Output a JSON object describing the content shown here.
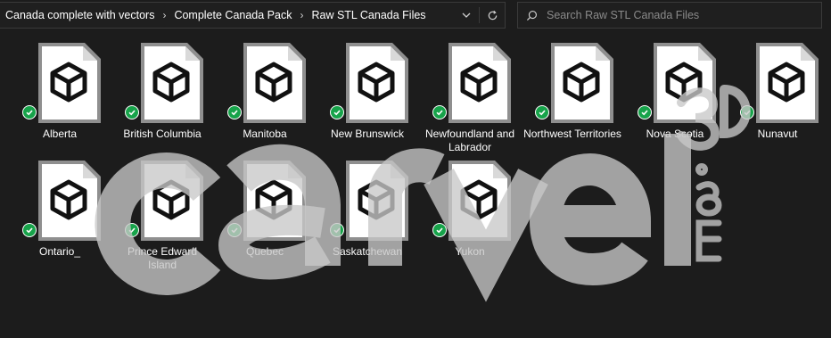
{
  "breadcrumb": {
    "items": [
      "Canada complete with vectors",
      "Complete Canada Pack",
      "Raw STL Canada Files"
    ],
    "separator": "›"
  },
  "search": {
    "placeholder": "Search Raw STL Canada Files"
  },
  "files": [
    {
      "label": "Alberta"
    },
    {
      "label": "British Columbia"
    },
    {
      "label": "Manitoba"
    },
    {
      "label": "New Brunswick"
    },
    {
      "label": "Newfoundland and Labrador"
    },
    {
      "label": "Northwest Territories"
    },
    {
      "label": "Nova Scotia"
    },
    {
      "label": "Nunavut"
    },
    {
      "label": "Ontario_"
    },
    {
      "label": "Prince Edward Island"
    },
    {
      "label": "Quebec"
    },
    {
      "label": "Saskatchewan"
    },
    {
      "label": "Yukon"
    }
  ],
  "watermark": {
    "word": "carved",
    "superscript": "3D",
    "suffix": ".com"
  },
  "colors": {
    "background": "#1c1c1c",
    "sync_ok": "#17a34a",
    "watermark": "#c8c8c8"
  },
  "icons": {
    "file": "stl-3d-object-file-icon",
    "status": "sync-available-check-icon",
    "search": "search-icon",
    "dropdown": "chevron-down-icon",
    "refresh": "refresh-icon"
  }
}
